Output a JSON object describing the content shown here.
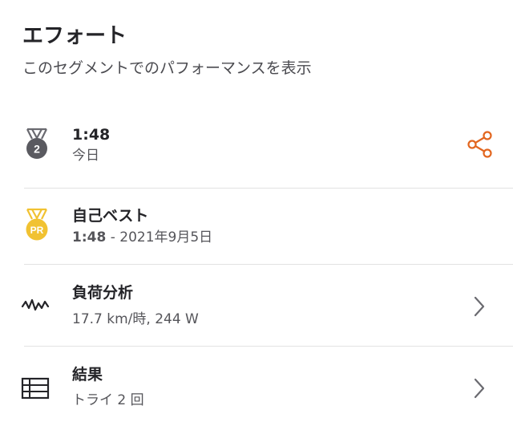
{
  "header": {
    "title": "エフォート",
    "subtitle": "このセグメントでのパフォーマンスを表示"
  },
  "effort": {
    "rank_badge": "2",
    "time": "1:48",
    "date": "今日",
    "icon": "medal-silver-icon",
    "action_icon": "share-icon",
    "accent_color": "#e2661f"
  },
  "personal_record": {
    "badge": "PR",
    "label": "自己ベスト",
    "time": "1:48",
    "separator": " - ",
    "date": "2021年9月5日",
    "icon": "medal-gold-icon",
    "badge_color": "#f1c232"
  },
  "analysis": {
    "label": "負荷分析",
    "detail": "17.7 km/時, 244 W",
    "icon": "waveform-icon"
  },
  "results": {
    "label": "結果",
    "detail": "トライ 2 回",
    "icon": "table-icon"
  }
}
